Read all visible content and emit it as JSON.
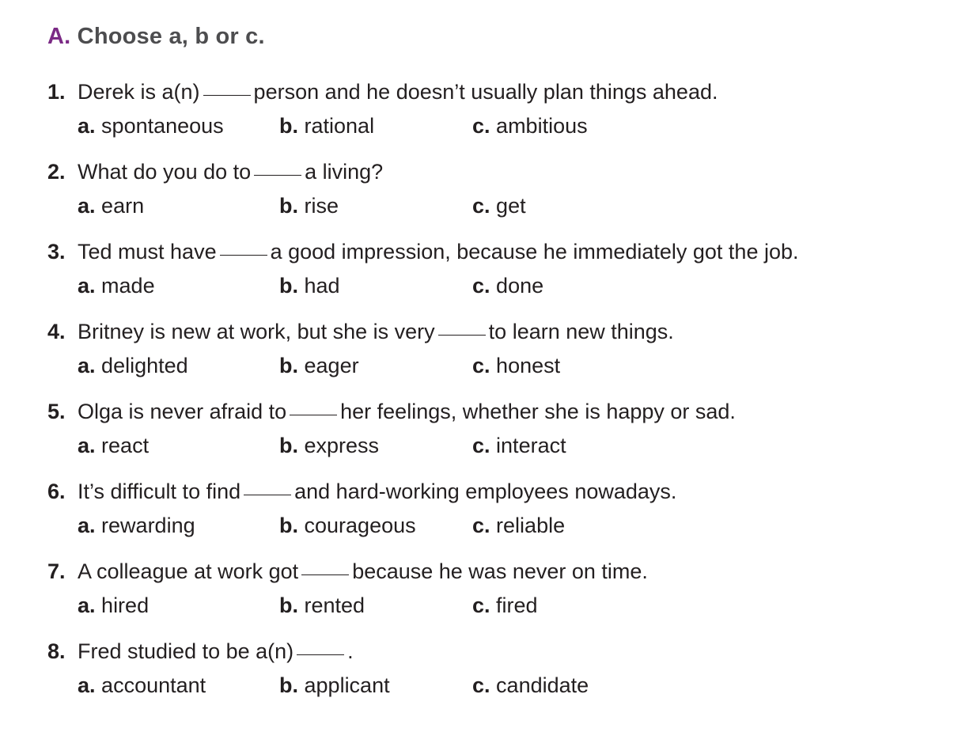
{
  "exercise": {
    "letter": "A.",
    "title": "Choose a, b or c."
  },
  "questions": [
    {
      "number": "1.",
      "before": "Derek is a(n)",
      "after": "person and he doesn’t usually plan things ahead.",
      "options": [
        {
          "letter": "a.",
          "text": "spontaneous"
        },
        {
          "letter": "b.",
          "text": "rational"
        },
        {
          "letter": "c.",
          "text": "ambitious"
        }
      ]
    },
    {
      "number": "2.",
      "before": "What do you do to",
      "after": "a living?",
      "options": [
        {
          "letter": "a.",
          "text": "earn"
        },
        {
          "letter": "b.",
          "text": "rise"
        },
        {
          "letter": "c.",
          "text": "get"
        }
      ]
    },
    {
      "number": "3.",
      "before": "Ted must have",
      "after": "a good impression, because he immediately got the job.",
      "options": [
        {
          "letter": "a.",
          "text": "made"
        },
        {
          "letter": "b.",
          "text": "had"
        },
        {
          "letter": "c.",
          "text": "done"
        }
      ]
    },
    {
      "number": "4.",
      "before": "Britney is new at work, but she is very",
      "after": "to learn new things.",
      "options": [
        {
          "letter": "a.",
          "text": "delighted"
        },
        {
          "letter": "b.",
          "text": "eager"
        },
        {
          "letter": "c.",
          "text": "honest"
        }
      ]
    },
    {
      "number": "5.",
      "before": "Olga is never afraid to",
      "after": "her feelings, whether she is happy or sad.",
      "options": [
        {
          "letter": "a.",
          "text": "react"
        },
        {
          "letter": "b.",
          "text": "express"
        },
        {
          "letter": "c.",
          "text": "interact"
        }
      ]
    },
    {
      "number": "6.",
      "before": "It’s difficult to find",
      "after": "and hard-working employees nowadays.",
      "options": [
        {
          "letter": "a.",
          "text": "rewarding"
        },
        {
          "letter": "b.",
          "text": "courageous"
        },
        {
          "letter": "c.",
          "text": "reliable"
        }
      ]
    },
    {
      "number": "7.",
      "before": "A colleague at work got",
      "after": "because he was never on time.",
      "options": [
        {
          "letter": "a.",
          "text": "hired"
        },
        {
          "letter": "b.",
          "text": "rented"
        },
        {
          "letter": "c.",
          "text": "fired"
        }
      ]
    },
    {
      "number": "8.",
      "before": "Fred studied to be a(n)",
      "after": ".",
      "options": [
        {
          "letter": "a.",
          "text": "accountant"
        },
        {
          "letter": "b.",
          "text": "applicant"
        },
        {
          "letter": "c.",
          "text": "candidate"
        }
      ]
    }
  ]
}
